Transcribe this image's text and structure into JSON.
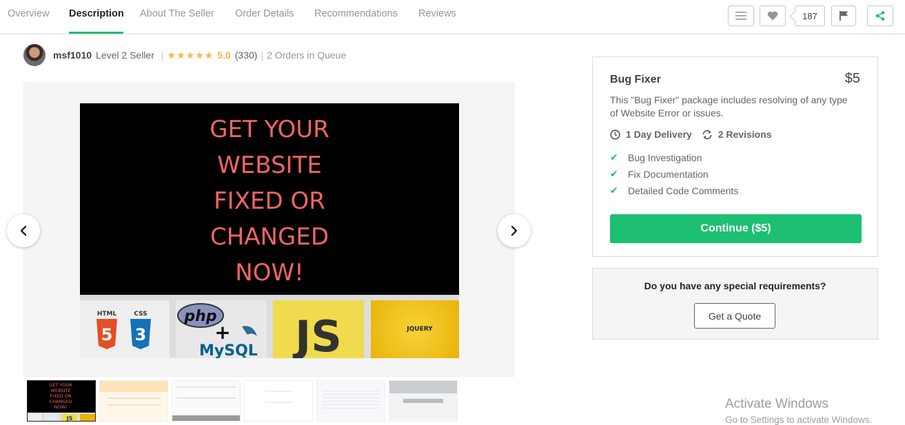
{
  "nav": {
    "tabs": [
      "Overview",
      "Description",
      "About The Seller",
      "Order Details",
      "Recommendations",
      "Reviews"
    ],
    "active_tab": "Description",
    "like_count": "187"
  },
  "seller": {
    "username": "msf1010",
    "level": "Level 2 Seller",
    "stars": "★★★★★",
    "rating": "5.0",
    "reviews": "(330)",
    "queue": "2 Orders in Queue"
  },
  "gallery": {
    "slide_lines": [
      "GET YOUR",
      "WEBSITE",
      "FIXED OR",
      "CHANGED",
      "NOW!"
    ],
    "tile_html": "HTML",
    "tile_css": "CSS",
    "tile_html_num": "5",
    "tile_css_num": "3",
    "tile_php": "php",
    "tile_plus": "+",
    "tile_mysql": "MySQL",
    "tile_js": "JS",
    "tile_jquery": "JQUERY",
    "thumb_lines": [
      "GET YOUR",
      "WEBSITE",
      "FIXED OR",
      "CHANGED",
      "NOW!"
    ],
    "thumb_js": "JS"
  },
  "package": {
    "name": "Bug Fixer",
    "price": "$5",
    "description": "This \"Bug Fixer\" package includes resolving of any type of Website Error or issues.",
    "delivery": "1 Day Delivery",
    "revisions": "2 Revisions",
    "features": [
      "Bug Investigation",
      "Fix Documentation",
      "Detailed Code Comments"
    ],
    "cta": "Continue ($5)",
    "accent": "#1dbf73"
  },
  "quote": {
    "question": "Do you have any special requirements?",
    "button": "Get a Quote"
  },
  "watermark": {
    "line1": "Activate Windows",
    "line2": "Go to Settings to activate Windows."
  }
}
